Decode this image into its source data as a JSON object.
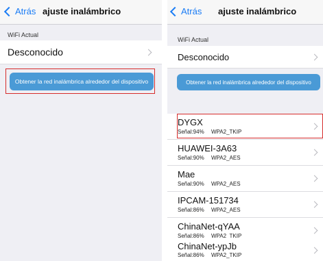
{
  "colors": {
    "accent": "#1a7cf5",
    "button": "#4a9ad6",
    "highlight": "#d62b2b",
    "background": "#efeff4"
  },
  "left": {
    "back_label": "Atrás",
    "title": "ajuste inalámbrico",
    "section_label": "WiFi Actual",
    "current_network": "Desconocido",
    "scan_button": "Obtener la red inalámbrica alrededor del dispositivo"
  },
  "right": {
    "back_label": "Atrás",
    "title": "ajuste inalámbrico",
    "section_label": "WiFi Actual",
    "current_network": "Desconocido",
    "scan_button": "Obtener la red inalámbrica alrededor del dispositivo",
    "networks": [
      {
        "name": "DYGX",
        "signal": "Señal:94%",
        "security": "WPA2_TKIP"
      },
      {
        "name": "HUAWEI-3A63",
        "signal": "Señal:90%",
        "security": "WPA2_AES"
      },
      {
        "name": "Mae",
        "signal": "Señal:90%",
        "security": "WPA2_AES"
      },
      {
        "name": "IPCAM-151734",
        "signal": "Señal:86%",
        "security": "WPA2_AES"
      },
      {
        "name": "ChinaNet-qYAA",
        "signal": "Señal:86%",
        "security": "WPA2_TKIP"
      },
      {
        "name": "ChinaNet-ypJb",
        "signal": "Señal:86%",
        "security": "WPA2_TKIP"
      }
    ]
  }
}
